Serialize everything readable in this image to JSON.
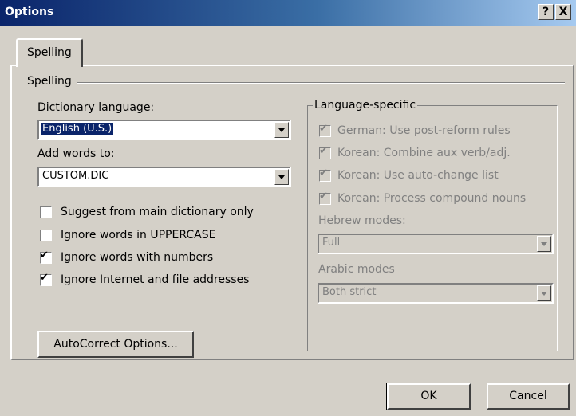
{
  "window": {
    "title": "Options",
    "help_label": "?",
    "close_label": "X"
  },
  "tabs": [
    {
      "label": "Spelling",
      "selected": true
    }
  ],
  "section": {
    "title": "Spelling"
  },
  "dictionary_language": {
    "label": "Dictionary language:",
    "value": "English (U.S.)"
  },
  "add_words_to": {
    "label": "Add words to:",
    "value": "CUSTOM.DIC"
  },
  "options": [
    {
      "label": "Suggest from main dictionary only",
      "checked": false
    },
    {
      "label": "Ignore words in UPPERCASE",
      "checked": false
    },
    {
      "label": "Ignore words with numbers",
      "checked": true
    },
    {
      "label": "Ignore Internet and file addresses",
      "checked": true
    }
  ],
  "autocorrect_button": "AutoCorrect Options...",
  "language_specific": {
    "title": "Language-specific",
    "options": [
      {
        "label": "German: Use post-reform rules",
        "checked": true
      },
      {
        "label": "Korean: Combine aux verb/adj.",
        "checked": true
      },
      {
        "label": "Korean: Use auto-change list",
        "checked": true
      },
      {
        "label": "Korean: Process compound nouns",
        "checked": true
      }
    ],
    "hebrew_modes": {
      "label": "Hebrew modes:",
      "value": "Full"
    },
    "arabic_modes": {
      "label": "Arabic modes",
      "value": "Both strict"
    }
  },
  "buttons": {
    "ok": "OK",
    "cancel": "Cancel"
  }
}
